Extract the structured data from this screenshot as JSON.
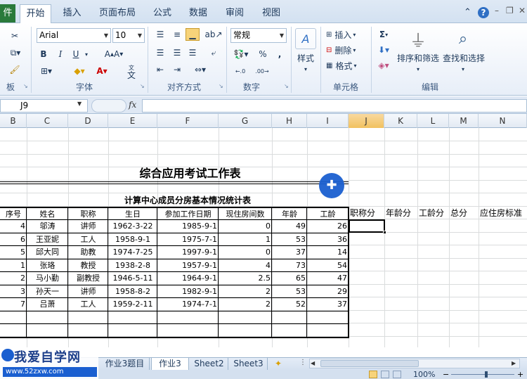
{
  "tabs": {
    "file": "件",
    "items": [
      "开始",
      "插入",
      "页面布局",
      "公式",
      "数据",
      "审阅",
      "视图"
    ]
  },
  "ribbon": {
    "groups": [
      "板",
      "字体",
      "对齐方式",
      "数字",
      "单元格",
      "编辑"
    ],
    "font_name": "Arial",
    "font_size": "10",
    "number_format": "常规",
    "style_label": "样式",
    "insert_label": "插入",
    "delete_label": "删除",
    "format_label": "格式",
    "sort_filter_label": "排序和筛选",
    "find_select_label": "查找和选择",
    "bold": "B",
    "italic": "I",
    "underline": "U",
    "percent": "%",
    "comma": ",",
    "sigma": "Σ",
    "ab": "ab",
    "wen": "文"
  },
  "formula_bar": {
    "name_box": "J9",
    "fx": "fx",
    "content": ""
  },
  "columns": [
    "B",
    "C",
    "D",
    "E",
    "F",
    "G",
    "H",
    "I",
    "J",
    "K",
    "L",
    "M",
    "N"
  ],
  "selected_column": "J",
  "sheet": {
    "title": "综合应用考试工作表",
    "subtitle": "计算中心成员分房基本情况统计表",
    "headers": [
      "序号",
      "姓名",
      "职称",
      "生日",
      "参加工作日期",
      "现住房间数",
      "年龄",
      "工龄"
    ],
    "extra_headers": [
      "职称分",
      "年龄分",
      "工龄分",
      "总分",
      "应住房标准"
    ],
    "rows": [
      [
        "4",
        "邬涛",
        "讲师",
        "1962-3-22",
        "1985-9-1",
        "0",
        "49",
        "26"
      ],
      [
        "6",
        "王亚妮",
        "工人",
        "1958-9-1",
        "1975-7-1",
        "1",
        "53",
        "36"
      ],
      [
        "5",
        "邱大同",
        "助教",
        "1974-7-25",
        "1997-9-1",
        "0",
        "37",
        "14"
      ],
      [
        "1",
        "张珞",
        "教授",
        "1938-2-8",
        "1957-9-1",
        "4",
        "73",
        "54"
      ],
      [
        "2",
        "马小勤",
        "副教授",
        "1946-5-11",
        "1964-9-1",
        "2.5",
        "65",
        "47"
      ],
      [
        "3",
        "孙天一",
        "讲师",
        "1958-8-2",
        "1982-9-1",
        "2",
        "53",
        "29"
      ],
      [
        "7",
        "吕萧",
        "工人",
        "1959-2-11",
        "1974-7-1",
        "2",
        "52",
        "37"
      ]
    ]
  },
  "sheet_tabs": [
    "作业3题目",
    "作业3",
    "Sheet2",
    "Sheet3"
  ],
  "active_sheet_tab": "作业3",
  "watermark": {
    "logo": "我爱自学网",
    "url": "www.52zxw.com"
  },
  "zoom": "100%",
  "colors": {
    "accent": "#2a7a3b",
    "ribbon_text": "#1e395b",
    "cursor": "#1a5fd0",
    "selected_header": "#f1c15f"
  }
}
